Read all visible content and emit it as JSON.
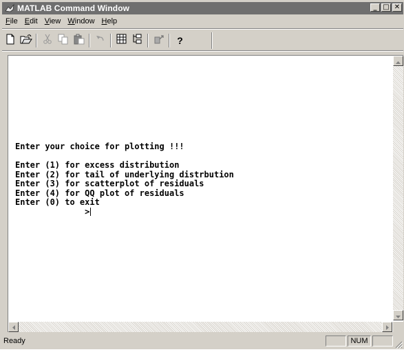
{
  "window": {
    "title": "MATLAB Command Window"
  },
  "title_buttons": [
    "_",
    "□",
    "✕"
  ],
  "menu": [
    {
      "label_ul": "F",
      "label_rest": "ile"
    },
    {
      "label_ul": "E",
      "label_rest": "dit"
    },
    {
      "label_ul": "V",
      "label_rest": "iew"
    },
    {
      "label_ul": "W",
      "label_rest": "indow"
    },
    {
      "label_ul": "H",
      "label_rest": "elp"
    }
  ],
  "toolbar": {
    "icons": [
      "new-file-icon",
      "open-file-icon",
      "cut-icon",
      "copy-icon",
      "paste-icon",
      "undo-icon",
      "workspace-browser-icon",
      "path-browser-icon",
      "simulink-icon",
      "help-icon"
    ],
    "help_glyph": "?"
  },
  "console": {
    "lines": [
      "Enter your choice for plotting !!!",
      "",
      "Enter (1) for excess distribution",
      "Enter (2) for tail of underlying distrbution",
      "Enter (3) for scatterplot of residuals",
      "Enter (4) for QQ plot of residuals",
      "Enter (0) to exit"
    ],
    "prompt": "              >"
  },
  "status": {
    "text": "Ready",
    "num": "NUM"
  },
  "colors": {
    "title_bar": "#6f6f6f",
    "window_face": "#d4d0c8"
  }
}
